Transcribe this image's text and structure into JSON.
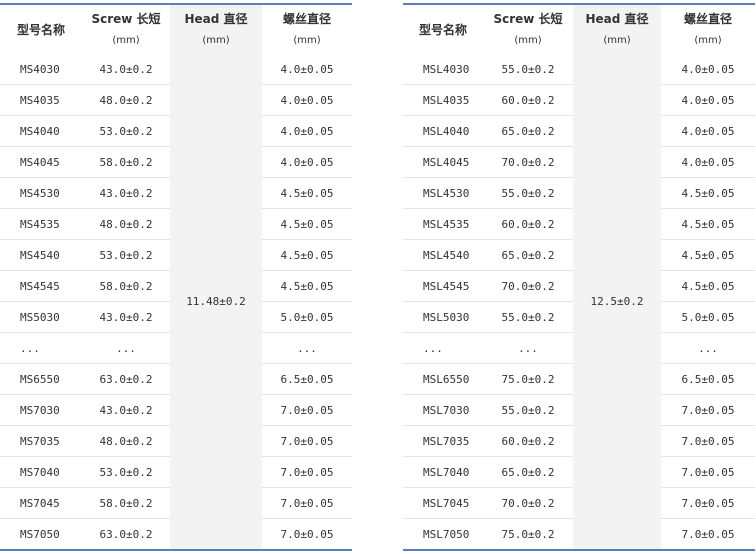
{
  "left": {
    "headers": {
      "model": "型号名称",
      "screw": "Screw 长短",
      "screw_unit": "(mm)",
      "head": "Head 直径",
      "head_unit": "(mm)",
      "thread": "螺丝直径",
      "thread_unit": "(mm)"
    },
    "head_value": "11.48±0.2",
    "rows": [
      {
        "model": "MS4030",
        "screw": "43.0±0.2",
        "thread": "4.0±0.05"
      },
      {
        "model": "MS4035",
        "screw": "48.0±0.2",
        "thread": "4.0±0.05"
      },
      {
        "model": "MS4040",
        "screw": "53.0±0.2",
        "thread": "4.0±0.05"
      },
      {
        "model": "MS4045",
        "screw": "58.0±0.2",
        "thread": "4.0±0.05"
      },
      {
        "model": "MS4530",
        "screw": "43.0±0.2",
        "thread": "4.5±0.05"
      },
      {
        "model": "MS4535",
        "screw": "48.0±0.2",
        "thread": "4.5±0.05"
      },
      {
        "model": "MS4540",
        "screw": "53.0±0.2",
        "thread": "4.5±0.05"
      },
      {
        "model": "MS4545",
        "screw": "58.0±0.2",
        "thread": "4.5±0.05"
      },
      {
        "model": "MS5030",
        "screw": "43.0±0.2",
        "thread": "5.0±0.05"
      },
      {
        "model": "...",
        "screw": "...",
        "thread": "..."
      },
      {
        "model": "MS6550",
        "screw": "63.0±0.2",
        "thread": "6.5±0.05"
      },
      {
        "model": "MS7030",
        "screw": "43.0±0.2",
        "thread": "7.0±0.05"
      },
      {
        "model": "MS7035",
        "screw": "48.0±0.2",
        "thread": "7.0±0.05"
      },
      {
        "model": "MS7040",
        "screw": "53.0±0.2",
        "thread": "7.0±0.05"
      },
      {
        "model": "MS7045",
        "screw": "58.0±0.2",
        "thread": "7.0±0.05"
      },
      {
        "model": "MS7050",
        "screw": "63.0±0.2",
        "thread": "7.0±0.05"
      }
    ]
  },
  "right": {
    "headers": {
      "model": "型号名称",
      "screw": "Screw 长短",
      "screw_unit": "(mm)",
      "head": "Head 直径",
      "head_unit": "(mm)",
      "thread": "螺丝直径",
      "thread_unit": "(mm)"
    },
    "head_value": "12.5±0.2",
    "rows": [
      {
        "model": "MSL4030",
        "screw": "55.0±0.2",
        "thread": "4.0±0.05"
      },
      {
        "model": "MSL4035",
        "screw": "60.0±0.2",
        "thread": "4.0±0.05"
      },
      {
        "model": "MSL4040",
        "screw": "65.0±0.2",
        "thread": "4.0±0.05"
      },
      {
        "model": "MSL4045",
        "screw": "70.0±0.2",
        "thread": "4.0±0.05"
      },
      {
        "model": "MSL4530",
        "screw": "55.0±0.2",
        "thread": "4.5±0.05"
      },
      {
        "model": "MSL4535",
        "screw": "60.0±0.2",
        "thread": "4.5±0.05"
      },
      {
        "model": "MSL4540",
        "screw": "65.0±0.2",
        "thread": "4.5±0.05"
      },
      {
        "model": "MSL4545",
        "screw": "70.0±0.2",
        "thread": "4.5±0.05"
      },
      {
        "model": "MSL5030",
        "screw": "55.0±0.2",
        "thread": "5.0±0.05"
      },
      {
        "model": "...",
        "screw": "...",
        "thread": "..."
      },
      {
        "model": "MSL6550",
        "screw": "75.0±0.2",
        "thread": "6.5±0.05"
      },
      {
        "model": "MSL7030",
        "screw": "55.0±0.2",
        "thread": "7.0±0.05"
      },
      {
        "model": "MSL7035",
        "screw": "60.0±0.2",
        "thread": "7.0±0.05"
      },
      {
        "model": "MSL7040",
        "screw": "65.0±0.2",
        "thread": "7.0±0.05"
      },
      {
        "model": "MSL7045",
        "screw": "70.0±0.2",
        "thread": "7.0±0.05"
      },
      {
        "model": "MSL7050",
        "screw": "75.0±0.2",
        "thread": "7.0±0.05"
      }
    ]
  },
  "colors": {
    "rule": "#5b7fbd",
    "shade": "#f3f3f3",
    "row_line": "#e4e4e4",
    "text": "#333333"
  }
}
